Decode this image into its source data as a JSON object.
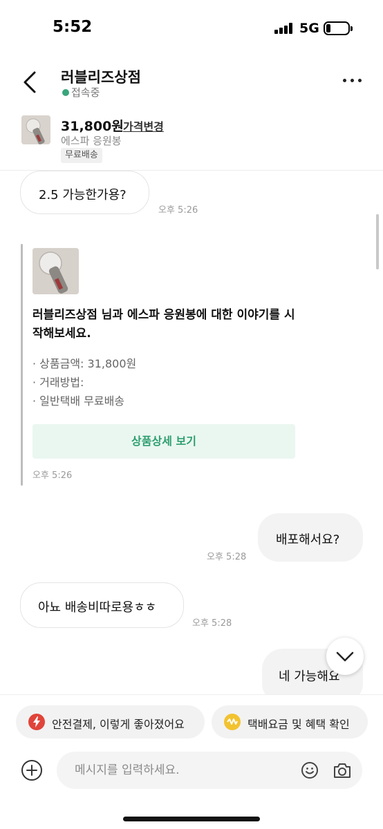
{
  "status_bar": {
    "time": "5:52",
    "network": "5G",
    "battery_level": 0.2
  },
  "header": {
    "shop_name": "러블리즈상점",
    "online_status": "접속중",
    "online_color": "#3aa57c"
  },
  "product": {
    "price": "31,800원",
    "price_change": "가격변경",
    "name": "에스파 응원봉",
    "shipping_badge": "무료배송"
  },
  "messages": [
    {
      "direction": "in",
      "text": "2.5 가능한가용?",
      "time": "오후 5:26"
    },
    {
      "direction": "out",
      "text": "배포해서요?",
      "time": "오후 5:28"
    },
    {
      "direction": "in",
      "text": "아뇨 배송비따로용ㅎㅎ",
      "time": "오후 5:28"
    },
    {
      "direction": "out",
      "text": "네 가능해요"
    }
  ],
  "product_card": {
    "title": "러블리즈상점 님과 에스파 응원봉에 대한 이야기를 시작해보세요.",
    "price_line": "· 상품금액: 31,800원",
    "method_label": "· 거래방법:",
    "method_value": "· 일반택배 무료배송",
    "detail_button": "상품상세 보기",
    "time": "오후 5:26",
    "accent_color": "#2e9e6f"
  },
  "quick_actions": [
    {
      "label": "안전결제, 이렇게 좋아졌어요",
      "icon": "lightning-icon",
      "color": "#e0443a"
    },
    {
      "label": "택배요금 및 혜택 확인",
      "icon": "coin-icon",
      "color": "#f2c230"
    }
  ],
  "composer": {
    "placeholder": "메시지를 입력하세요."
  }
}
